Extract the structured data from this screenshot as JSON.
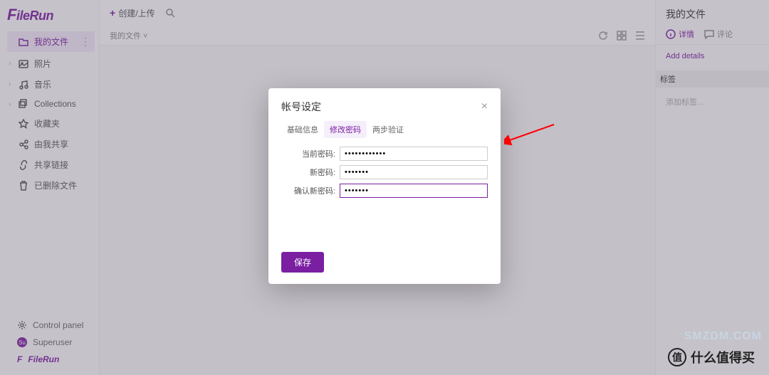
{
  "logo": "FileRun",
  "sidebar": {
    "items": [
      {
        "label": "我的文件",
        "icon": "folder",
        "active": true
      },
      {
        "label": "照片",
        "icon": "image"
      },
      {
        "label": "音乐",
        "icon": "music"
      },
      {
        "label": "Collections",
        "icon": "copy"
      },
      {
        "label": "收藏夹",
        "icon": "star"
      },
      {
        "label": "由我共享",
        "icon": "share"
      },
      {
        "label": "共享链接",
        "icon": "link"
      },
      {
        "label": "已删除文件",
        "icon": "trash"
      }
    ]
  },
  "footer": {
    "control_panel": "Control panel",
    "user": "Superuser",
    "user_initials": "Su",
    "brand": "FileRun"
  },
  "topbar": {
    "create_label": "创建/上传"
  },
  "breadcrumb": "我的文件 ˅",
  "right": {
    "title": "我的文件",
    "tabs": {
      "details": "详情",
      "comments": "评论"
    },
    "add_details": "Add details",
    "tags_label": "标签",
    "add_tags": "添加标签..."
  },
  "dialog": {
    "title": "帐号设定",
    "tabs": {
      "basic": "基础信息",
      "password": "修改密码",
      "twofa": "两步验证"
    },
    "fields": {
      "current_label": "当前密码:",
      "current_value": "••••••••••••",
      "new_label": "新密码:",
      "new_value": "•••••••",
      "confirm_label": "确认新密码:",
      "confirm_value": "•••••••"
    },
    "save": "保存"
  },
  "watermark": "什么值得买",
  "watermark_badge": "值",
  "corner_text": "SMZDM.COM"
}
